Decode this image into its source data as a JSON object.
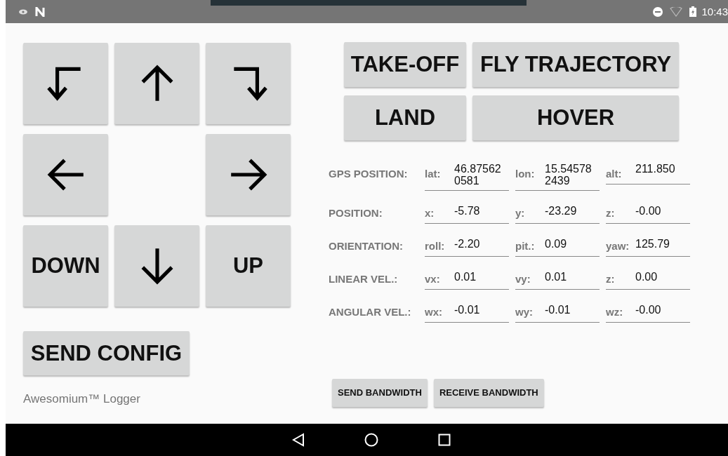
{
  "status_bar": {
    "time": "10:43"
  },
  "pad": [
    {
      "kind": "turn-left"
    },
    {
      "kind": "up"
    },
    {
      "kind": "turn-right"
    },
    {
      "kind": "left"
    },
    {
      "kind": "empty"
    },
    {
      "kind": "right"
    },
    {
      "kind": "text",
      "label": "DOWN"
    },
    {
      "kind": "down"
    },
    {
      "kind": "text",
      "label": "UP"
    }
  ],
  "send_config": "SEND CONFIG",
  "footer_text": "Awesomium™ Logger",
  "actions": [
    "TAKE-OFF",
    "FLY TRAJECTORY",
    "LAND",
    "HOVER"
  ],
  "telemetry": [
    {
      "label": "GPS POSITION:",
      "fields": [
        {
          "name": "lat:",
          "value": "46.87562\n0581"
        },
        {
          "name": "lon:",
          "value": "15.54578\n2439"
        },
        {
          "name": "alt:",
          "value": "211.850"
        }
      ]
    },
    {
      "label": "POSITION:",
      "fields": [
        {
          "name": "x:",
          "value": "-5.78"
        },
        {
          "name": "y:",
          "value": "-23.29"
        },
        {
          "name": "z:",
          "value": "-0.00"
        }
      ]
    },
    {
      "label": "ORIENTATION:",
      "fields": [
        {
          "name": "roll:",
          "value": "-2.20"
        },
        {
          "name": "pit.:",
          "value": "0.09"
        },
        {
          "name": "yaw:",
          "value": "125.79"
        }
      ]
    },
    {
      "label": "LINEAR VEL.:",
      "fields": [
        {
          "name": "vx:",
          "value": "0.01"
        },
        {
          "name": "vy:",
          "value": "0.01"
        },
        {
          "name": "z:",
          "value": "0.00"
        }
      ]
    },
    {
      "label": "ANGULAR VEL.:",
      "fields": [
        {
          "name": "wx:",
          "value": "-0.01"
        },
        {
          "name": "wy:",
          "value": "-0.01"
        },
        {
          "name": "wz:",
          "value": "-0.00"
        }
      ]
    }
  ],
  "bandwidth_buttons": [
    "SEND BANDWIDTH",
    "RECEIVE BANDWIDTH"
  ]
}
